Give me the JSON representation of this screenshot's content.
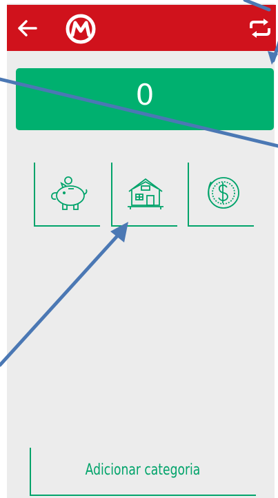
{
  "header": {
    "back_icon": "arrow-left-icon",
    "logo_icon": "m-logo-icon",
    "swap_icon": "repeat-icon",
    "color": "#d0121c"
  },
  "balance_card": {
    "value": "0",
    "color": "#00b06f"
  },
  "categories": [
    {
      "icon": "piggy-bank-icon"
    },
    {
      "icon": "house-icon"
    },
    {
      "icon": "coin-dollar-icon"
    }
  ],
  "add_category_label": "Adicionar categoria",
  "accent_color": "#00a36a"
}
